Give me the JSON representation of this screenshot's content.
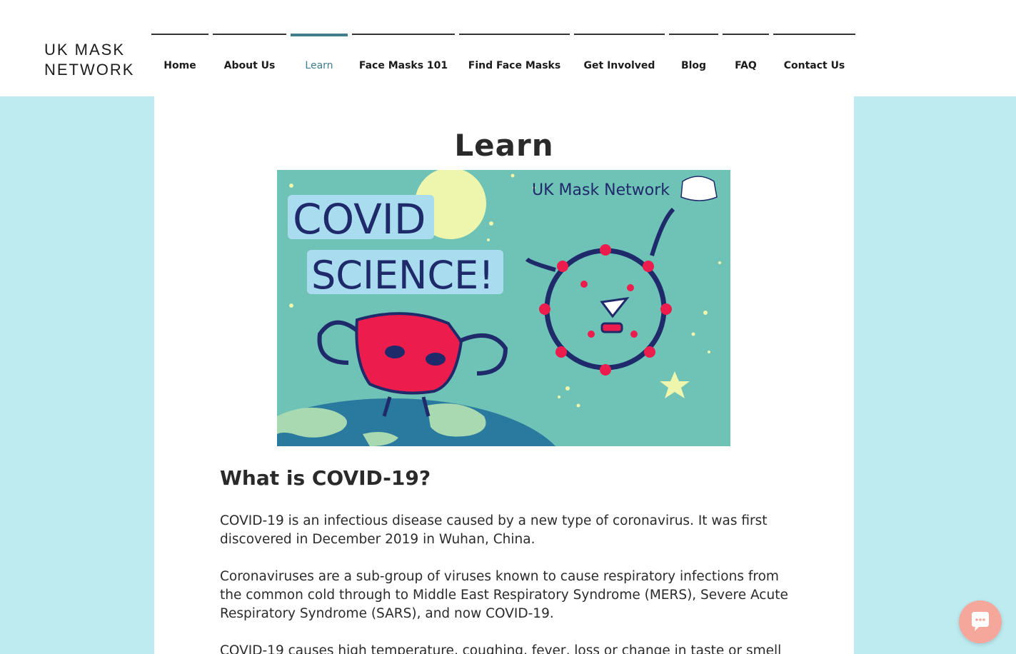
{
  "logo": {
    "line1": "UK MASK",
    "line2": "NETWORK"
  },
  "nav": {
    "items": [
      {
        "label": "Home",
        "active": false
      },
      {
        "label": "About Us",
        "active": false
      },
      {
        "label": "Learn",
        "active": true
      },
      {
        "label": "Face Masks 101",
        "active": false
      },
      {
        "label": "Find Face Masks",
        "active": false
      },
      {
        "label": "Get Involved",
        "active": false
      },
      {
        "label": "Blog",
        "active": false
      },
      {
        "label": "FAQ",
        "active": false
      },
      {
        "label": "Contact Us",
        "active": false
      }
    ]
  },
  "page": {
    "title": "Learn"
  },
  "hero": {
    "line1": "COVID",
    "line2": "SCIENCE!",
    "brand": "UK Mask Network"
  },
  "section": {
    "heading": "What is COVID-19?",
    "paragraphs": [
      "COVID-19 is an infectious disease caused by a new type of coronavirus. It was first discovered in December 2019 in Wuhan, China.",
      "Coronaviruses are a sub-group of viruses known to cause respiratory infections from the common cold through to Middle East Respiratory Syndrome (MERS), Severe Acute Respiratory Syndrome (SARS), and now COVID-19.",
      "COVID-19 causes high temperature, coughing, fever, loss or change in taste or smell"
    ]
  },
  "colors": {
    "page_bg": "#bdebf0",
    "accent": "#3f7d8c",
    "hero_bg": "#6fc2b6",
    "chat": "#f4a79a"
  },
  "icons": {
    "chat": "chat-bubble-icon"
  }
}
